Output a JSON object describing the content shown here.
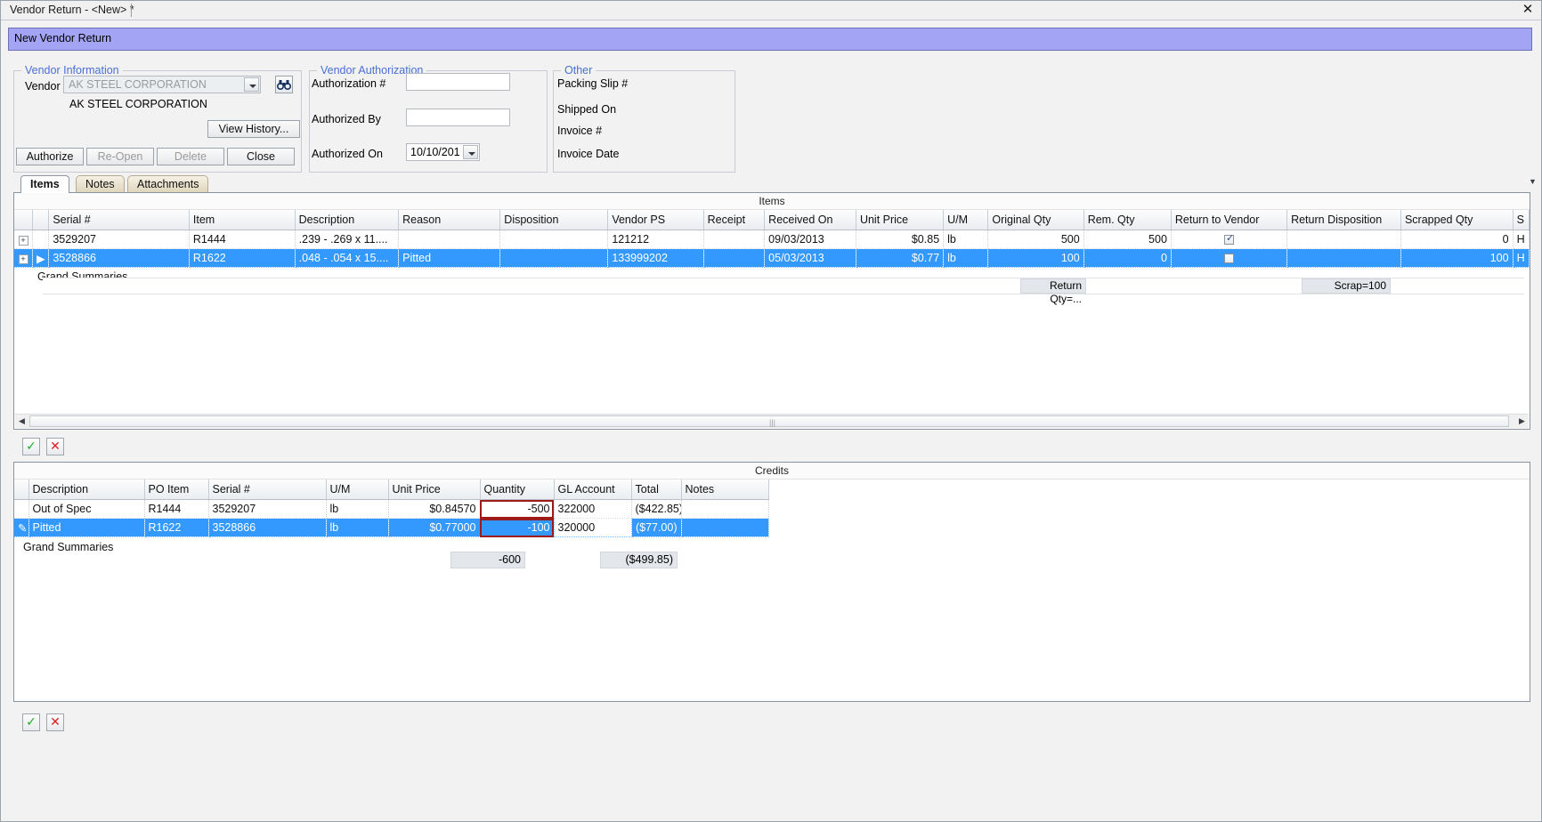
{
  "window": {
    "tab_title": "Vendor Return - <New> *",
    "close_label": "✕",
    "banner_title": "New Vendor Return"
  },
  "vendor_information": {
    "legend": "Vendor Information",
    "vendor_label": "Vendor",
    "vendor_value": "AK STEEL CORPORATION",
    "vendor_resolved_name": "AK STEEL CORPORATION",
    "search_icon": "binoculars-icon",
    "view_history_label": "View History...",
    "buttons": [
      {
        "label": "Authorize",
        "enabled": true
      },
      {
        "label": "Re-Open",
        "enabled": false
      },
      {
        "label": "Delete",
        "enabled": false
      },
      {
        "label": "Close",
        "enabled": true
      }
    ]
  },
  "vendor_authorization": {
    "legend": "Vendor Authorization",
    "authorization_number_label": "Authorization #",
    "authorization_number_value": "",
    "authorized_by_label": "Authorized By",
    "authorized_by_value": "",
    "authorized_on_label": "Authorized On",
    "authorized_on_value": "10/10/201"
  },
  "other": {
    "legend": "Other",
    "fields": [
      {
        "label": "Packing Slip #",
        "value": ""
      },
      {
        "label": "Shipped On",
        "value": ""
      },
      {
        "label": "Invoice #",
        "value": ""
      },
      {
        "label": "Invoice Date",
        "value": ""
      }
    ]
  },
  "tabs": [
    {
      "label": "Items",
      "active": true
    },
    {
      "label": "Notes",
      "active": false
    },
    {
      "label": "Attachments",
      "active": false
    }
  ],
  "items_grid": {
    "caption": "Items",
    "columns": [
      "Serial #",
      "Item",
      "Description",
      "Reason",
      "Disposition",
      "Vendor PS",
      "Receipt",
      "Received On",
      "Unit Price",
      "U/M",
      "Original Qty",
      "Rem. Qty",
      "Return to Vendor",
      "Return Disposition",
      "Scrapped Qty",
      "S"
    ],
    "rows": [
      {
        "selected": false,
        "indicator": "",
        "serial": "3529207",
        "item": "R1444",
        "description": ".239 - .269 x 11....",
        "reason": "",
        "disposition": "",
        "vendor_ps": "121212",
        "receipt": "",
        "received_on": "09/03/2013",
        "unit_price": "$0.85",
        "um": "lb",
        "original_qty": "500",
        "rem_qty": "500",
        "return_to_vendor": true,
        "return_disposition": "",
        "scrapped_qty": "0",
        "last": "H"
      },
      {
        "selected": true,
        "indicator": "▶",
        "serial": "3528866",
        "item": "R1622",
        "description": ".048 - .054  x 15....",
        "reason": "Pitted",
        "disposition": "",
        "vendor_ps": "133999202",
        "receipt": "",
        "received_on": "05/03/2013",
        "unit_price": "$0.77",
        "um": "lb",
        "original_qty": "100",
        "rem_qty": "0",
        "return_to_vendor": false,
        "return_disposition": "",
        "scrapped_qty": "100",
        "last": "H"
      }
    ],
    "summary_label": "Grand Summaries",
    "summary_return_qty": "Return Qty=...",
    "summary_scrap": "Scrap=100"
  },
  "items_toolbar": {
    "accept_icon": "check-icon",
    "accept_label": "✓",
    "cancel_icon": "x-icon",
    "cancel_label": "✕"
  },
  "credits_grid": {
    "caption": "Credits",
    "columns": [
      "Description",
      "PO Item",
      "Serial #",
      "U/M",
      "Unit Price",
      "Quantity",
      "GL Account",
      "Total",
      "Notes"
    ],
    "rows": [
      {
        "selected": false,
        "indicator": "",
        "description": "Out of Spec",
        "po_item": "R1444",
        "serial": "3529207",
        "um": "lb",
        "unit_price": "$0.84570",
        "quantity": "-500",
        "gl_account": "322000",
        "total": "($422.85)",
        "notes": "",
        "quantity_editing": true
      },
      {
        "selected": true,
        "indicator": "✎",
        "description": "Pitted",
        "po_item": "R1622",
        "serial": "3528866",
        "um": "lb",
        "unit_price": "$0.77000",
        "quantity": "-100",
        "gl_account": "320000",
        "total": "($77.00)",
        "notes": "",
        "quantity_editing": true,
        "gl_account_editing": true
      }
    ],
    "summary_label": "Grand Summaries",
    "summary_quantity": "-600",
    "summary_total": "($499.85)"
  },
  "credits_toolbar": {
    "accept_label": "✓",
    "cancel_label": "✕"
  },
  "colors": {
    "banner": "#a3a5f4",
    "selection": "#3399ff",
    "legend_text": "#4a6fd4",
    "edit_outline": "#9e1b1b"
  }
}
